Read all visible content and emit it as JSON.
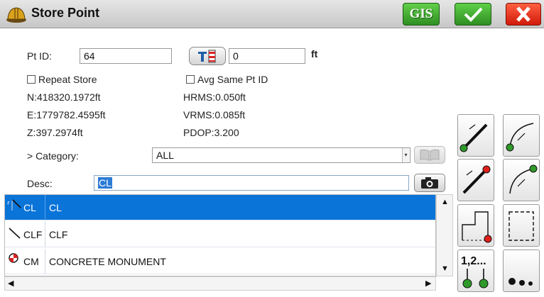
{
  "window": {
    "title": "Store Point",
    "gis_label": "GIS"
  },
  "form": {
    "pt_id_label": "Pt ID:",
    "pt_id_value": "64",
    "offset_value": "0",
    "offset_unit": "ft",
    "repeat_store_label": "Repeat Store",
    "avg_same_label": "Avg Same Pt ID",
    "northing": "N:418320.1972ft",
    "easting": "E:1779782.4595ft",
    "elevation": "Z:397.2974ft",
    "hrms": "HRMS:0.050ft",
    "vrms": "VRMS:0.085ft",
    "pdop": "PDOP:3.200",
    "category_label": "> Category:",
    "category_value": "ALL",
    "desc_label": "Desc:",
    "desc_value": "CL"
  },
  "codes": [
    {
      "code": "CL",
      "name": "CL",
      "icon": "line-code-icon",
      "selected": true
    },
    {
      "code": "CLF",
      "name": "CLF",
      "icon": "line-code-icon",
      "selected": false
    },
    {
      "code": "CM",
      "name": "CONCRETE MONUMENT",
      "icon": "monument-icon",
      "selected": false
    }
  ],
  "tools": {
    "line_start": "line-start-icon",
    "arc_start": "arc-start-icon",
    "line_end": "line-end-icon",
    "arc_end": "arc-end-icon",
    "close_shape": "close-shape-icon",
    "rect_shape": "rect-shape-icon",
    "sequence_label": "1,2...",
    "more": "more-icon"
  },
  "colors": {
    "selection": "#0a74d8",
    "green": "#2f9a2a",
    "red": "#e0201c"
  }
}
